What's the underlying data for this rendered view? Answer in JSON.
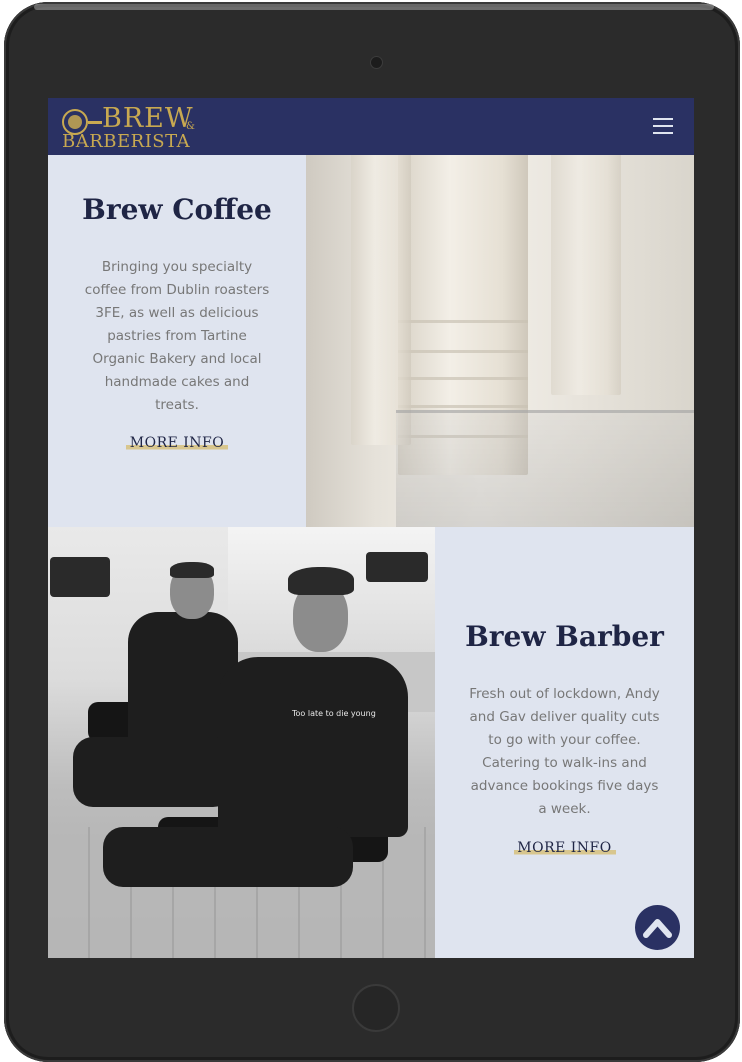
{
  "brand": {
    "logo_line1": "BREW",
    "logo_amp": "&",
    "logo_line2": "BARBERISTA",
    "accent": "#c8a951",
    "navy": "#2a3163",
    "panel_bg": "#dfe4ef"
  },
  "nav": {
    "menu_icon": "hamburger-icon"
  },
  "coffee": {
    "title": "Brew Coffee",
    "description": "Bringing you specialty coffee from Dublin roasters 3FE, as well as delicious pastries from Tartine Organic Bakery and local handmade cakes and treats.",
    "button_label": "MORE INFO"
  },
  "barber": {
    "title": "Brew Barber",
    "description": "Fresh out of lockdown, Andy and Gav deliver quality cuts to go with your coffee. Catering to walk-ins and advance bookings five days a week.",
    "button_label": "MORE INFO",
    "hoodie_text": "Too late to die young"
  },
  "back_to_top": {
    "icon": "chevron-up-icon"
  }
}
